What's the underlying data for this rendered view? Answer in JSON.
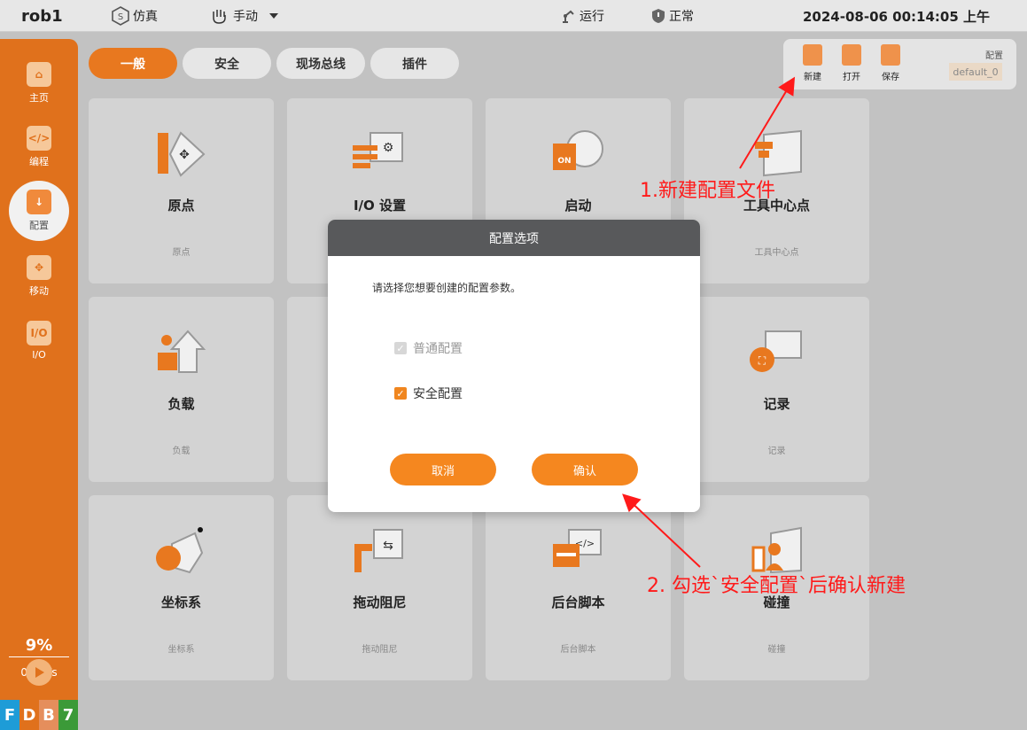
{
  "topbar": {
    "robot": "rob1",
    "sim_label": "仿真",
    "mode_label": "手动",
    "run_label": "运行",
    "status_label": "正常",
    "datetime": "2024-08-06 00:14:05 上午"
  },
  "sidebar": {
    "items": [
      {
        "label": "主页",
        "icon": "home-icon"
      },
      {
        "label": "编程",
        "icon": "code-icon"
      },
      {
        "label": "配置",
        "icon": "config-icon"
      },
      {
        "label": "移动",
        "icon": "move-icon"
      },
      {
        "label": "I/O",
        "icon": "io-icon"
      }
    ],
    "speed_percent": "9%",
    "speed_mm": "0mm/s",
    "footer_badges": [
      "F",
      "D",
      "B",
      "7"
    ],
    "footer_colors": [
      "#1e9cd7",
      "#e0711c",
      "#e58e5c",
      "#3b9a38"
    ]
  },
  "tabs": [
    "一般",
    "安全",
    "现场总线",
    "插件"
  ],
  "toolbar": {
    "new_label": "新建",
    "open_label": "打开",
    "save_label": "保存",
    "config_label": "配置",
    "config_value": "default_0"
  },
  "cards": [
    {
      "title": "原点",
      "sub": "原点"
    },
    {
      "title": "I/O 设置",
      "sub": ""
    },
    {
      "title": "启动",
      "sub": ""
    },
    {
      "title": "工具中心点",
      "sub": "工具中心点"
    },
    {
      "title": "负载",
      "sub": "负载"
    },
    {
      "title": "",
      "sub": ""
    },
    {
      "title": "",
      "sub": ""
    },
    {
      "title": "记录",
      "sub": "记录"
    },
    {
      "title": "坐标系",
      "sub": "坐标系"
    },
    {
      "title": "拖动阻尼",
      "sub": "拖动阻尼"
    },
    {
      "title": "后台脚本",
      "sub": "后台脚本"
    },
    {
      "title": "碰撞",
      "sub": "碰撞"
    }
  ],
  "modal": {
    "title": "配置选项",
    "prompt": "请选择您想要创建的配置参数。",
    "option_normal": "普通配置",
    "option_safety": "安全配置",
    "cancel": "取消",
    "confirm": "确认"
  },
  "annotations": {
    "step1": "1.新建配置文件",
    "step2": "2. 勾选`安全配置`后确认新建"
  },
  "colors": {
    "accent": "#e8781f",
    "annotation": "#ff1a1a"
  }
}
